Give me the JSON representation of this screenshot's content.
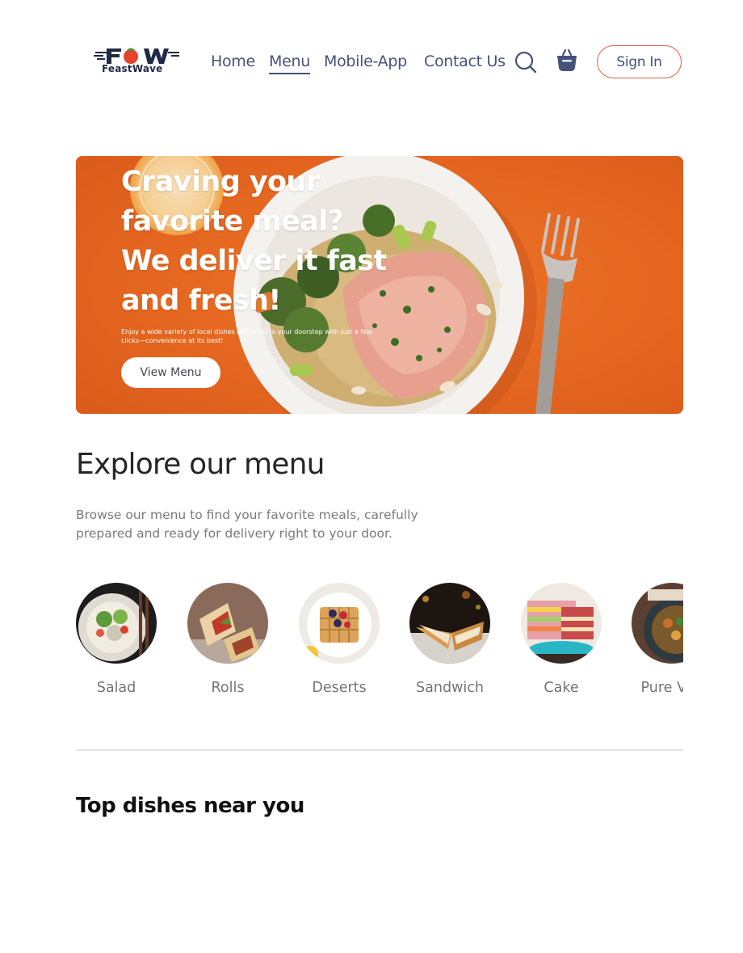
{
  "brand": {
    "logo_mark": "FOW",
    "name": "FeastWave"
  },
  "nav": {
    "items": [
      {
        "label": "Home",
        "active": false
      },
      {
        "label": "Menu",
        "active": true
      },
      {
        "label": "Mobile-App",
        "active": false
      },
      {
        "label": "Contact Us",
        "active": false
      }
    ],
    "search_icon": "search-icon",
    "basket_icon": "basket-icon",
    "signin_label": "Sign In"
  },
  "hero": {
    "title": "Craving your favorite meal? We deliver it fast and fresh!",
    "subtitle": "Enjoy a wide variety of local dishes delivered to your doorstep with just a few clicks—convenience at its best!",
    "button_label": "View Menu",
    "accent": "#ea6a23"
  },
  "explore": {
    "title": "Explore our menu",
    "description": "Browse our menu to find your favorite meals, carefully prepared and ready for delivery right to your door.",
    "categories": [
      {
        "label": "Salad"
      },
      {
        "label": "Rolls"
      },
      {
        "label": "Deserts"
      },
      {
        "label": "Sandwich"
      },
      {
        "label": "Cake"
      },
      {
        "label": "Pure Veg"
      }
    ]
  },
  "top_dishes": {
    "title": "Top dishes near you"
  },
  "colors": {
    "nav_text": "#45527a",
    "signin_border": "#e6604a",
    "heading": "#262626",
    "muted": "#7a7a7a"
  }
}
